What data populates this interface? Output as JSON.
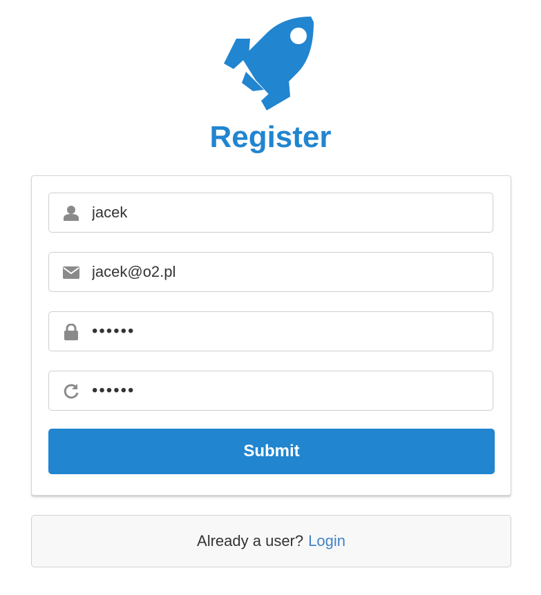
{
  "header": {
    "logo_icon": "rocket-icon",
    "title": "Register"
  },
  "form": {
    "fields": [
      {
        "icon": "user-icon",
        "type": "text",
        "value": "jacek"
      },
      {
        "icon": "envelope-icon",
        "type": "email",
        "value": "jacek@o2.pl"
      },
      {
        "icon": "lock-icon",
        "type": "password",
        "value": "jacek1"
      },
      {
        "icon": "redo-icon",
        "type": "password",
        "value": "jacek1"
      }
    ],
    "submit_label": "Submit"
  },
  "footer": {
    "text": "Already a user?",
    "link_label": "Login"
  },
  "colors": {
    "primary": "#2185d0",
    "link": "#4183c4",
    "icon": "#8a8a8a"
  }
}
